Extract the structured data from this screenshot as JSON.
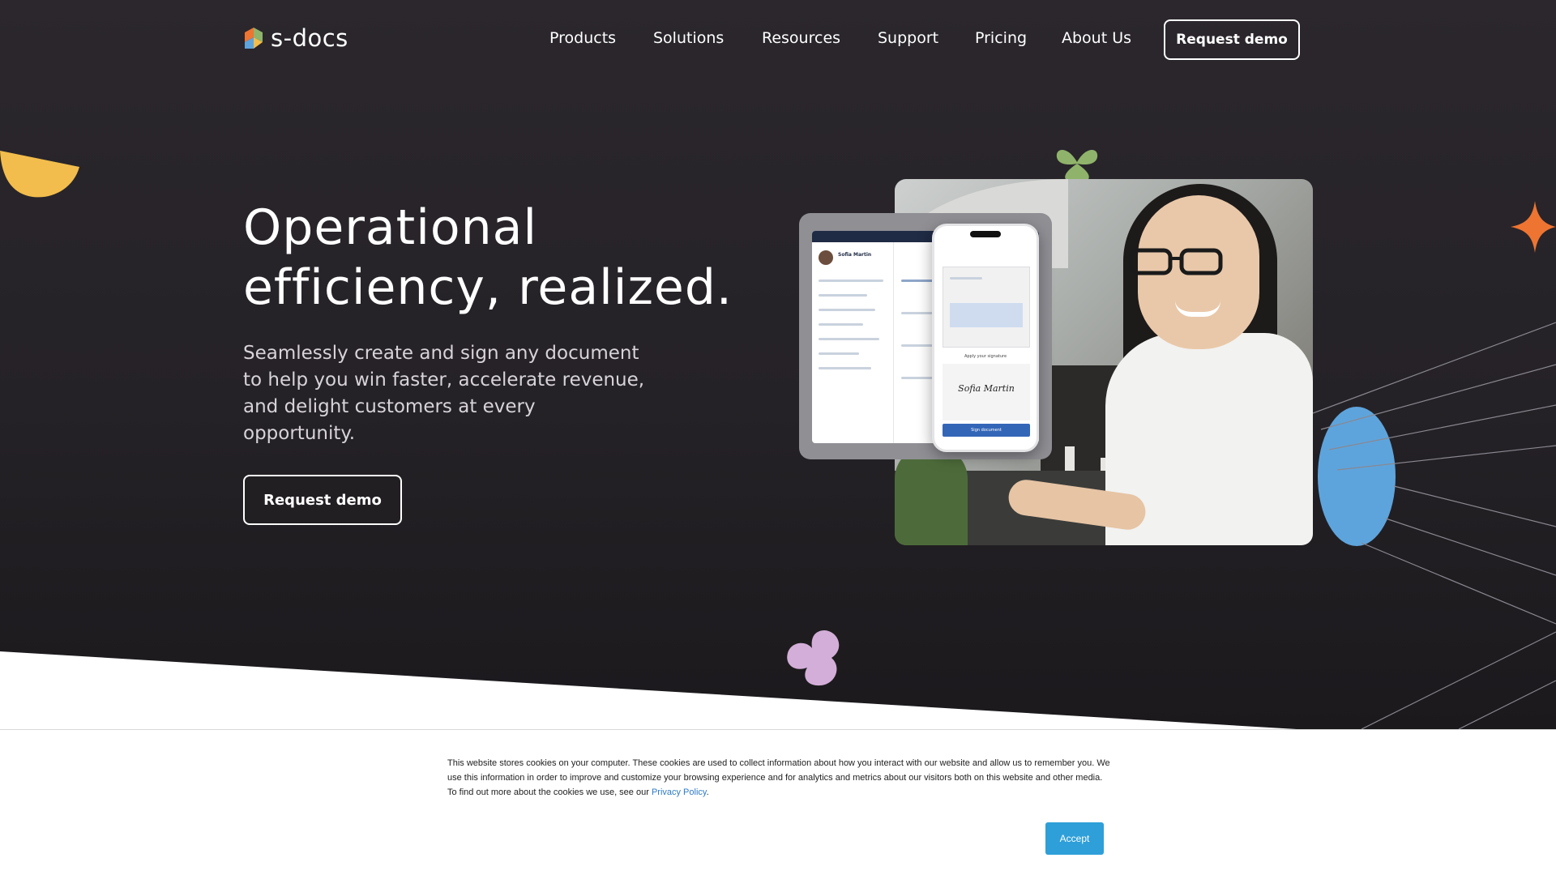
{
  "brand": {
    "name": "s-docs"
  },
  "nav": {
    "items": [
      "Products",
      "Solutions",
      "Resources",
      "Support",
      "Pricing",
      "About Us"
    ],
    "cta": "Request demo"
  },
  "hero": {
    "headline_line1": "Operational",
    "headline_line2": "efficiency, realized.",
    "subtext": "Seamlessly create and sign any document to help you win faster, accelerate revenue, and delight customers at every opportunity.",
    "cta": "Request demo"
  },
  "mockup": {
    "contact_name": "Sofia Martin",
    "apply_signature": "Apply your signature",
    "signature": "Sofia Martin",
    "sign_button": "Sign document"
  },
  "cookie_banner": {
    "text": "This website stores cookies on your computer. These cookies are used to collect information about how you interact with our website and allow us to remember you. We use this information in order to improve and customize your browsing experience and for analytics and metrics about our visitors both on this website and other media. To find out more about the cookies we use, see our",
    "link": "Privacy Policy",
    "link_suffix": ".",
    "accept": "Accept"
  },
  "colors": {
    "hero_bg": "#272429",
    "accent_yellow": "#f2bd4c",
    "accent_orange": "#ee7432",
    "accent_blue": "#5ea4dc",
    "accent_green": "#8fb36a",
    "accent_pink": "#d3aed8",
    "accept_button": "#2e9fd8"
  }
}
